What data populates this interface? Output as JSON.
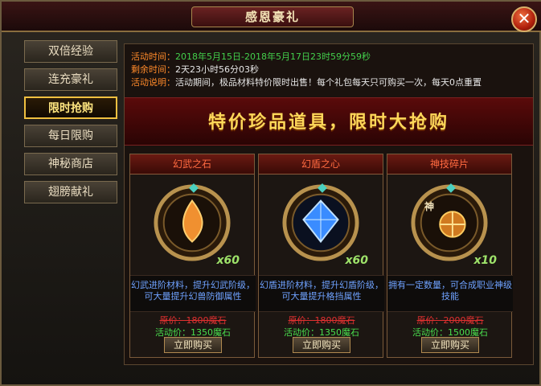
{
  "window": {
    "title": "感恩豪礼",
    "close_glyph": "✕"
  },
  "sidebar": {
    "items": [
      {
        "label": "双倍经验"
      },
      {
        "label": "连充豪礼"
      },
      {
        "label": "限时抢购",
        "active": true
      },
      {
        "label": "每日限购"
      },
      {
        "label": "神秘商店"
      },
      {
        "label": "翅膀献礼"
      }
    ]
  },
  "info": {
    "time_label": "活动时间：",
    "time_value": "2018年5月15日-2018年5月17日23时59分59秒",
    "remain_label": "剩余时间：",
    "remain_value": "2天23小时56分03秒",
    "desc_label": "活动说明：",
    "desc_value": "活动期间，极品材料特价限时出售！每个礼包每天只可购买一次，每天0点重置"
  },
  "banner": {
    "text": "特价珍品道具，限时大抢购"
  },
  "items": [
    {
      "name": "幻武之石",
      "qty": "x60",
      "desc": "幻武进阶材料，提升幻武阶级，可大量提升幻兽防御属性",
      "orig": "原价：1800魔石",
      "sale": "活动价：1350魔石",
      "buy": "立即购买",
      "gem_color": "#f09030",
      "gem_icon": "fire-gem-icon"
    },
    {
      "name": "幻盾之心",
      "qty": "x60",
      "desc": "幻盾进阶材料，提升幻盾阶级，可大量提升格挡属性",
      "orig": "原价：1800魔石",
      "sale": "活动价：1350魔石",
      "buy": "立即购买",
      "gem_color": "#3a8cff",
      "gem_icon": "blue-crystal-icon"
    },
    {
      "name": "神技碎片",
      "qty": "x10",
      "desc": "拥有一定数量，可合成职业神级技能",
      "orig": "原价：2000魔石",
      "sale": "活动价：1500魔石",
      "buy": "立即购买",
      "gem_color": "#d07a20",
      "gem_icon": "divine-shard-icon",
      "badge": "神"
    }
  ]
}
